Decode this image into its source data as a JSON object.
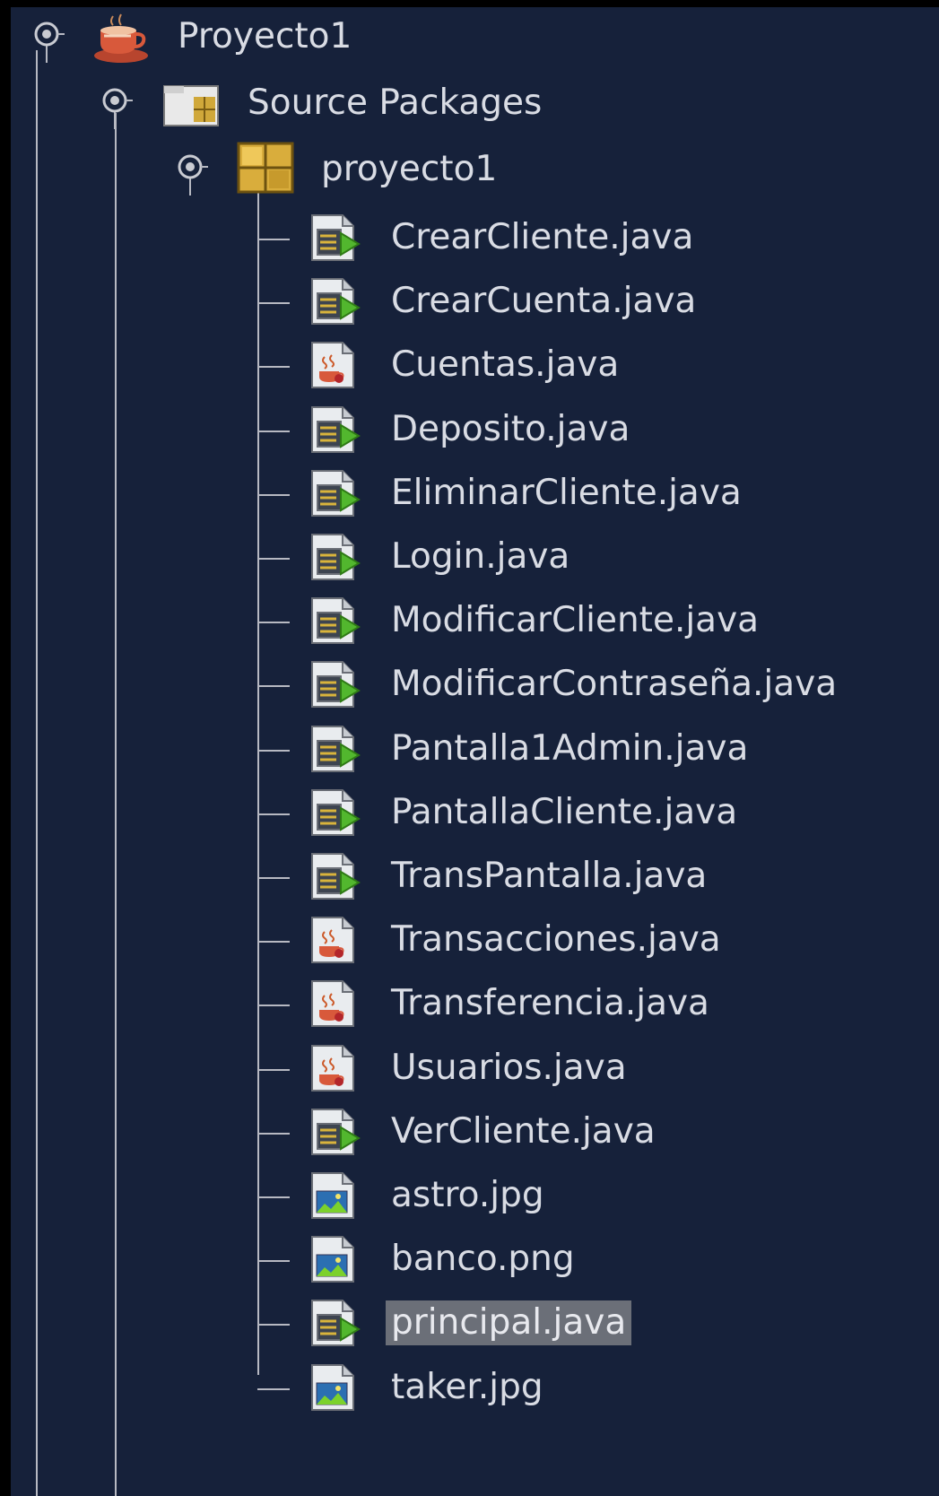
{
  "colors": {
    "panel_bg": "#16213a",
    "text": "#d9dce4",
    "selection_bg": "#6b6f78",
    "tree_lines": "#b7b9c2"
  },
  "tree": {
    "project": {
      "label": "Proyecto1",
      "icon": "java-project-cup-icon",
      "expanded": true
    },
    "source_packages": {
      "label": "Source Packages",
      "icon": "source-packages-folder-icon",
      "expanded": true
    },
    "package": {
      "label": "proyecto1",
      "icon": "package-icon",
      "expanded": true
    },
    "files": [
      {
        "label": "CrearCliente.java",
        "icon": "java-form-icon"
      },
      {
        "label": "CrearCuenta.java",
        "icon": "java-form-icon"
      },
      {
        "label": "Cuentas.java",
        "icon": "java-class-icon"
      },
      {
        "label": "Deposito.java",
        "icon": "java-form-icon"
      },
      {
        "label": "EliminarCliente.java",
        "icon": "java-form-icon"
      },
      {
        "label": "Login.java",
        "icon": "java-form-icon"
      },
      {
        "label": "ModificarCliente.java",
        "icon": "java-form-icon"
      },
      {
        "label": "ModificarContraseña.java",
        "icon": "java-form-icon"
      },
      {
        "label": "Pantalla1Admin.java",
        "icon": "java-form-icon"
      },
      {
        "label": "PantallaCliente.java",
        "icon": "java-form-icon"
      },
      {
        "label": "TransPantalla.java",
        "icon": "java-form-icon"
      },
      {
        "label": "Transacciones.java",
        "icon": "java-class-icon"
      },
      {
        "label": "Transferencia.java",
        "icon": "java-class-icon"
      },
      {
        "label": "Usuarios.java",
        "icon": "java-class-icon"
      },
      {
        "label": "VerCliente.java",
        "icon": "java-form-icon"
      },
      {
        "label": "astro.jpg",
        "icon": "image-file-icon"
      },
      {
        "label": "banco.png",
        "icon": "image-file-icon"
      },
      {
        "label": "principal.java",
        "icon": "java-form-icon",
        "selected": true
      },
      {
        "label": "taker.jpg",
        "icon": "image-file-icon"
      }
    ]
  }
}
